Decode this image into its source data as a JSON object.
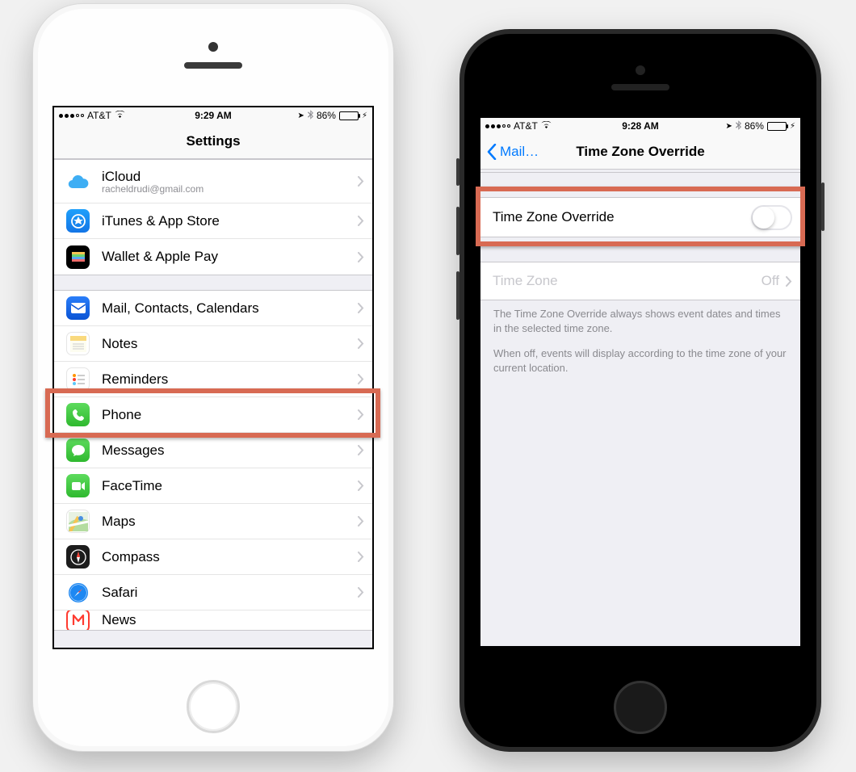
{
  "left": {
    "status": {
      "carrier": "AT&T",
      "time": "9:29 AM",
      "battery_pct": "86%"
    },
    "nav": {
      "title": "Settings"
    },
    "rows": {
      "icloud": {
        "label": "iCloud",
        "sub": "racheldrudi@gmail.com"
      },
      "itunes": {
        "label": "iTunes & App Store"
      },
      "wallet": {
        "label": "Wallet & Apple Pay"
      },
      "mail": {
        "label": "Mail, Contacts, Calendars"
      },
      "notes": {
        "label": "Notes"
      },
      "reminders": {
        "label": "Reminders"
      },
      "phone": {
        "label": "Phone"
      },
      "messages": {
        "label": "Messages"
      },
      "facetime": {
        "label": "FaceTime"
      },
      "maps": {
        "label": "Maps"
      },
      "compass": {
        "label": "Compass"
      },
      "safari": {
        "label": "Safari"
      },
      "news": {
        "label": "News"
      }
    }
  },
  "right": {
    "status": {
      "carrier": "AT&T",
      "time": "9:28 AM",
      "battery_pct": "86%"
    },
    "nav": {
      "back": "Mail…",
      "title": "Time Zone Override"
    },
    "toggle_row": {
      "label": "Time Zone Override",
      "on": false
    },
    "tz_row": {
      "label": "Time Zone",
      "value": "Off"
    },
    "foot1": "The Time Zone Override always shows event dates and times in the selected time zone.",
    "foot2": "When off, events will display according to the time zone of your current location."
  }
}
